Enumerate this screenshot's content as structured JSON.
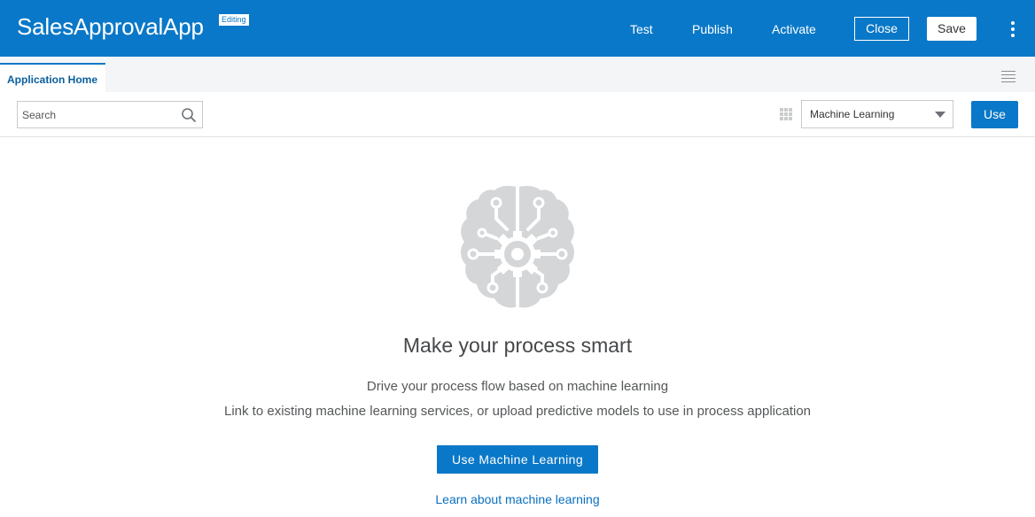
{
  "header": {
    "app_title": "SalesApprovalApp",
    "badge": "Editing",
    "links": [
      "Test",
      "Publish",
      "Activate"
    ],
    "close_label": "Close",
    "save_label": "Save",
    "menu_icon": "kebab-menu-icon"
  },
  "tabs": {
    "active_label": "Application Home",
    "list_icon": "list-icon"
  },
  "toolbar": {
    "search_placeholder": "Search",
    "search_icon": "search-icon",
    "grid_icon": "grid-view-icon",
    "select_value": "Machine Learning",
    "use_label": "Use"
  },
  "empty_state": {
    "illustration": "brain-gear-icon",
    "headline": "Make your process smart",
    "description_1": "Drive your process flow based on machine learning",
    "description_2": "Link to existing machine learning services, or upload predictive models to use in process application",
    "primary_button": "Use Machine Learning",
    "link": "Learn about machine learning"
  },
  "colors": {
    "brand": "#0a78c8",
    "illustration": "#d5d6d8",
    "link": "#0a6fbf"
  }
}
